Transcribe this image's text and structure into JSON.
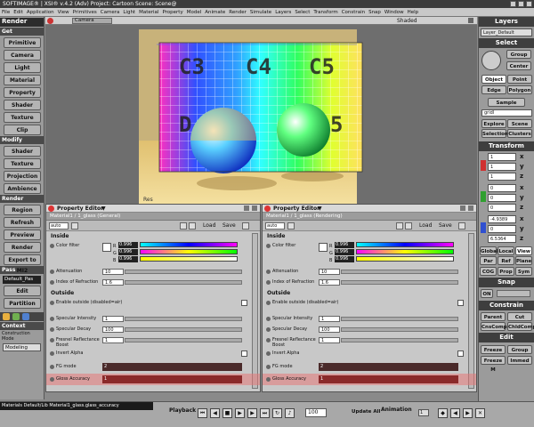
{
  "title": "SOFTIMAGE® | XSI® v.4.2 (Adv) Project: Cartoon   Scene: Scene@",
  "menu": [
    "File",
    "Edit",
    "Application",
    "View",
    "Primitives",
    "Camera",
    "Light",
    "Material",
    "Property",
    "Model",
    "Animate",
    "Render",
    "Simulate",
    "Layers",
    "Select",
    "Transform",
    "Constrain",
    "Snap",
    "Window",
    "Help"
  ],
  "left": {
    "render_header": "Render",
    "get_label": "Get",
    "get_buttons": [
      "Primitive",
      "Camera",
      "Light",
      "Material",
      "Property",
      "Shader",
      "Texture",
      "Clip"
    ],
    "modify_label": "Modify",
    "modify_buttons": [
      "Shader",
      "Texture",
      "Projection",
      "Ambience"
    ],
    "render_label": "Render",
    "render_buttons": [
      "Region",
      "Refresh",
      "Preview",
      "Render",
      "Export to MI2"
    ],
    "pass_label": "Pass",
    "pass_value": "Default_Pas",
    "pass_buttons": [
      "Edit",
      "Partition"
    ],
    "context_label": "Context",
    "construction_label": "Construction Mode",
    "construction_value": "Modeling"
  },
  "viewport": {
    "camera": "Camera",
    "mode": "Shaded",
    "res_label": "Res"
  },
  "right": {
    "layers": "Layers",
    "layer_value": "Layer_Default",
    "select": "Select",
    "select_buttons": [
      "Group",
      "Center",
      "Object",
      "Point",
      "Edge",
      "Polygon",
      "Sample"
    ],
    "field": "gridl",
    "explore": "Explore",
    "scene": "Scene",
    "selection": "Selection",
    "clusters": "Clusters",
    "transform": "Transform",
    "axes": [
      "x",
      "y",
      "z"
    ],
    "scale": [
      "1",
      "1",
      "1"
    ],
    "rotation": [
      "0",
      "0",
      "0"
    ],
    "translation": [
      "-4.9389",
      "0",
      "6.5364"
    ],
    "ref": [
      "Global",
      "Local",
      "View"
    ],
    "ref2": [
      "Par",
      "Ref",
      "Plane"
    ],
    "ref3": [
      "COG",
      "Prop",
      "Sym"
    ],
    "snap": "Snap",
    "snap_on": "ON",
    "constrain": "Constrain",
    "constrain_buttons": [
      "Parent",
      "Cut",
      "CnsComp",
      "ChldComp"
    ],
    "edit": "Edit",
    "edit_buttons": [
      "Freeze",
      "Group",
      "Freeze M",
      "Immed"
    ]
  },
  "pe1": {
    "title": "Property Editor",
    "name": "Material1 / 1_glass (General)",
    "preset": "auto",
    "load": "Load",
    "save": "Save"
  },
  "pe2": {
    "title": "Property Editor",
    "name": "Material1 / 1_glass (Rendering)",
    "preset": "auto",
    "load": "Load",
    "save": "Save"
  },
  "inside": "Inside",
  "outside": "Outside",
  "colorfilter": {
    "label": "Color filter",
    "rgb": [
      "0.996",
      "0.996",
      "0.996"
    ],
    "r": "R",
    "g": "G",
    "b": "B"
  },
  "attenuation": {
    "label": "Attenuation",
    "value": "10"
  },
  "ior": {
    "label": "Index of Refraction",
    "value": "1.6"
  },
  "enable_outside": "Enable outside (disabled=air)",
  "spec_int": {
    "label": "Specular Intensity",
    "value": "1"
  },
  "spec_decay": {
    "label": "Specular Decay",
    "value": "100"
  },
  "fresnel": {
    "label": "Fresnel Reflectance Boost",
    "value": "1"
  },
  "invert_alpha": "Invert Alpha",
  "fg_mode": {
    "label": "FG mode",
    "value": "2"
  },
  "gloss": {
    "label": "Gloss Accuracy",
    "value": "1"
  },
  "status": {
    "text": "Materials Default/Lib Material1_glass.glass_accuracy",
    "playback": "Playback",
    "frame": "100",
    "update": "Update All",
    "animation": "Animation",
    "frame2": "1"
  },
  "colors": {
    "ui": "#9b9b9b",
    "highlight": "#e07070"
  }
}
